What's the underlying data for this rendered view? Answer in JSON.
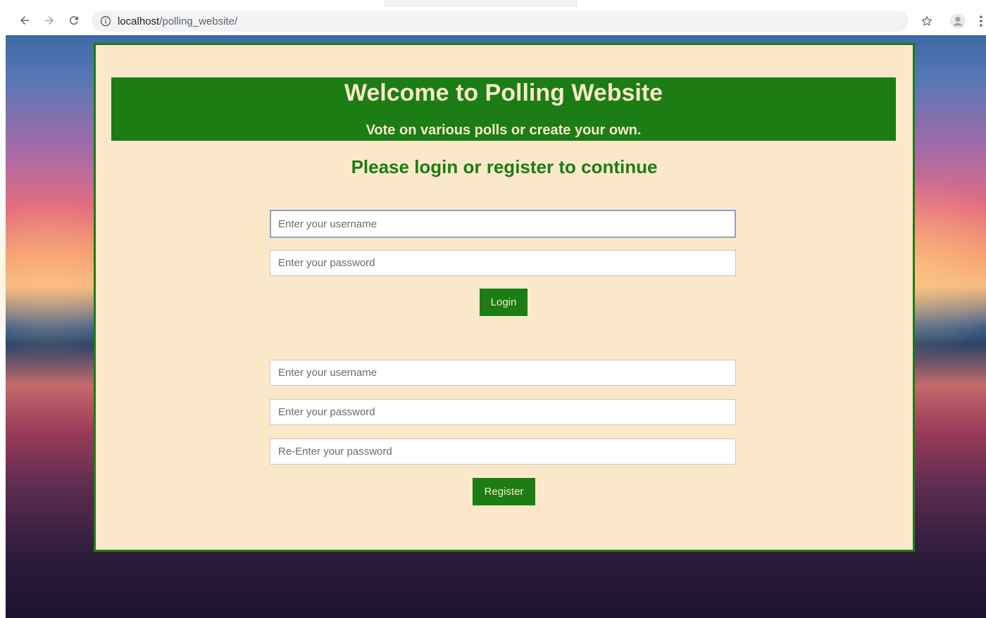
{
  "browser": {
    "url_host": "localhost",
    "url_path": "/polling_website/"
  },
  "hero": {
    "title": "Welcome to Polling Website",
    "subtitle": "Vote on various polls or create your own."
  },
  "prompt": "Please login or register to continue",
  "login_form": {
    "username_placeholder": "Enter your username",
    "password_placeholder": "Enter your password",
    "submit_label": "Login"
  },
  "register_form": {
    "username_placeholder": "Enter your username",
    "password_placeholder": "Enter your password",
    "confirm_password_placeholder": "Re-Enter your password",
    "submit_label": "Register"
  },
  "colors": {
    "accent_green": "#1b7d14",
    "card_background": "#fbe8c9"
  }
}
